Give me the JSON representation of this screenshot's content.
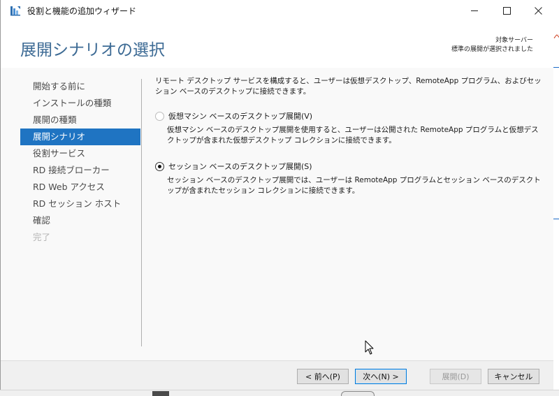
{
  "window": {
    "title": "役割と機能の追加ウィザード"
  },
  "header": {
    "page_title": "展開シナリオの選択",
    "target_label": "対象サーバー",
    "target_value": "標準の展開が選択されました"
  },
  "nav": {
    "items": [
      {
        "label": "開始する前に",
        "state": "normal"
      },
      {
        "label": "インストールの種類",
        "state": "normal"
      },
      {
        "label": "展開の種類",
        "state": "normal"
      },
      {
        "label": "展開シナリオ",
        "state": "selected"
      },
      {
        "label": "役割サービス",
        "state": "normal"
      },
      {
        "label": "RD 接続ブローカー",
        "state": "normal"
      },
      {
        "label": "RD Web アクセス",
        "state": "normal"
      },
      {
        "label": "RD セッション ホスト",
        "state": "normal"
      },
      {
        "label": "確認",
        "state": "normal"
      },
      {
        "label": "完了",
        "state": "disabled"
      }
    ]
  },
  "content": {
    "intro": "リモート デスクトップ サービスを構成すると、ユーザーは仮想デスクトップ、RemoteApp プログラム、およびセッション ベースのデスクトップに接続できます。",
    "option_vm": {
      "label": "仮想マシン ベースのデスクトップ展開(V)",
      "description": "仮想マシン ベースのデスクトップ展開を使用すると、ユーザーは公開された RemoteApp プログラムと仮想デスクトップが含まれた仮想デスクトップ コレクションに接続できます。",
      "checked": false
    },
    "option_session": {
      "label": "セッション ベースのデスクトップ展開(S)",
      "description": "セッション ベースのデスクトップ展開では、ユーザーは RemoteApp プログラムとセッション ベースのデスクトップが含まれたセッション コレクションに接続できます。",
      "checked": true
    }
  },
  "footer": {
    "prev_label": "< 前へ(P)",
    "next_label": "次へ(N) >",
    "deploy_label": "展開(D)",
    "cancel_label": "キャンセル"
  },
  "colors": {
    "accent": "#1f74c2",
    "title_blue": "#3c6a94"
  }
}
